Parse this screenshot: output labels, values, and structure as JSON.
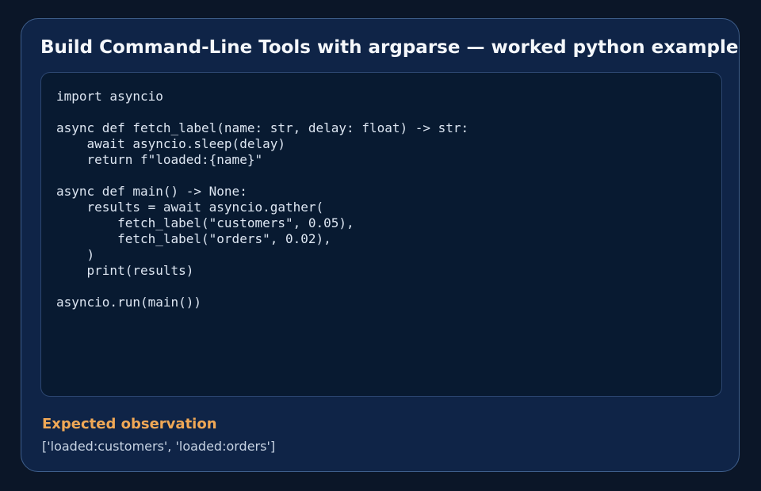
{
  "card": {
    "title": "Build Command-Line Tools with argparse — worked python example"
  },
  "code": {
    "language": "python",
    "lines": [
      "import asyncio",
      "",
      "async def fetch_label(name: str, delay: float) -> str:",
      "    await asyncio.sleep(delay)",
      "    return f\"loaded:{name}\"",
      "",
      "async def main() -> None:",
      "    results = await asyncio.gather(",
      "        fetch_label(\"customers\", 0.05),",
      "        fetch_label(\"orders\", 0.02),",
      "    )",
      "    print(results)",
      "",
      "asyncio.run(main())"
    ]
  },
  "observation": {
    "heading": "Expected observation",
    "text": "['loaded:customers', 'loaded:orders']"
  },
  "colors": {
    "background": "#0b1628",
    "card": "#0f2447",
    "code_panel": "#081a31",
    "accent": "#f0a856"
  }
}
